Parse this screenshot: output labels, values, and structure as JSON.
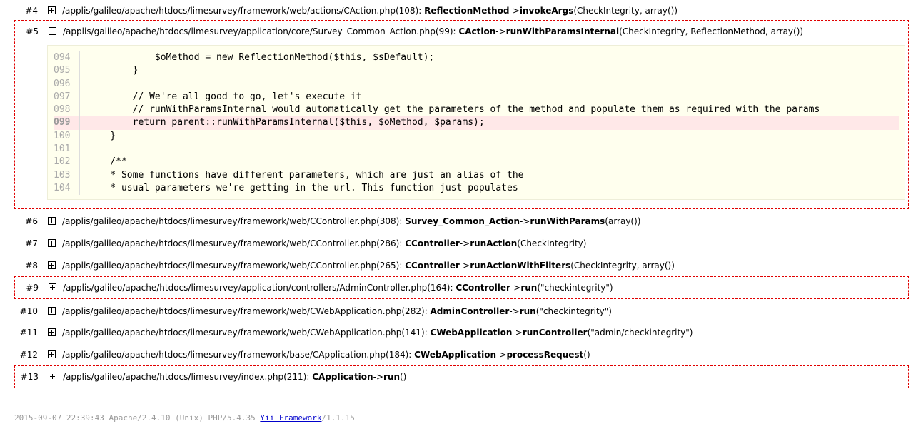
{
  "trace": [
    {
      "num": "#4",
      "path": "/applis/galileo/apache/htdocs/limesurvey/framework/web/actions/CAction.php(108):",
      "cls": "ReflectionMethod",
      "method": "invokeArgs",
      "args": "(CheckIntegrity, array())",
      "expanded": false,
      "boxed": false
    },
    {
      "num": "#5",
      "path": "/applis/galileo/apache/htdocs/limesurvey/application/core/Survey_Common_Action.php(99):",
      "cls": "CAction",
      "method": "runWithParamsInternal",
      "args": "(CheckIntegrity, ReflectionMethod, array())",
      "expanded": true,
      "boxed": true
    },
    {
      "num": "#6",
      "path": "/applis/galileo/apache/htdocs/limesurvey/framework/web/CController.php(308):",
      "cls": "Survey_Common_Action",
      "method": "runWithParams",
      "args": "(array())",
      "expanded": false,
      "boxed": false
    },
    {
      "num": "#7",
      "path": "/applis/galileo/apache/htdocs/limesurvey/framework/web/CController.php(286):",
      "cls": "CController",
      "method": "runAction",
      "args": "(CheckIntegrity)",
      "expanded": false,
      "boxed": false
    },
    {
      "num": "#8",
      "path": "/applis/galileo/apache/htdocs/limesurvey/framework/web/CController.php(265):",
      "cls": "CController",
      "method": "runActionWithFilters",
      "args": "(CheckIntegrity, array())",
      "expanded": false,
      "boxed": false
    },
    {
      "num": "#9",
      "path": "/applis/galileo/apache/htdocs/limesurvey/application/controllers/AdminController.php(164):",
      "cls": "CController",
      "method": "run",
      "args": "(\"checkintegrity\")",
      "expanded": false,
      "boxed": true
    },
    {
      "num": "#10",
      "path": "/applis/galileo/apache/htdocs/limesurvey/framework/web/CWebApplication.php(282):",
      "cls": "AdminController",
      "method": "run",
      "args": "(\"checkintegrity\")",
      "expanded": false,
      "boxed": false
    },
    {
      "num": "#11",
      "path": "/applis/galileo/apache/htdocs/limesurvey/framework/web/CWebApplication.php(141):",
      "cls": "CWebApplication",
      "method": "runController",
      "args": "(\"admin/checkintegrity\")",
      "expanded": false,
      "boxed": false
    },
    {
      "num": "#12",
      "path": "/applis/galileo/apache/htdocs/limesurvey/framework/base/CApplication.php(184):",
      "cls": "CWebApplication",
      "method": "processRequest",
      "args": "()",
      "expanded": false,
      "boxed": false
    },
    {
      "num": "#13",
      "path": "/applis/galileo/apache/htdocs/limesurvey/index.php(211):",
      "cls": "CApplication",
      "method": "run",
      "args": "()",
      "expanded": false,
      "boxed": true
    }
  ],
  "arrow": "->",
  "code": [
    {
      "ln": "094",
      "text": "            $oMethod = new ReflectionMethod($this, $sDefault);",
      "hl": false
    },
    {
      "ln": "095",
      "text": "        }",
      "hl": false
    },
    {
      "ln": "096",
      "text": "",
      "hl": false
    },
    {
      "ln": "097",
      "text": "        // We're all good to go, let's execute it",
      "hl": false
    },
    {
      "ln": "098",
      "text": "        // runWithParamsInternal would automatically get the parameters of the method and populate them as required with the params",
      "hl": false
    },
    {
      "ln": "099",
      "text": "        return parent::runWithParamsInternal($this, $oMethod, $params);",
      "hl": true
    },
    {
      "ln": "100",
      "text": "    }",
      "hl": false
    },
    {
      "ln": "101",
      "text": "",
      "hl": false
    },
    {
      "ln": "102",
      "text": "    /**",
      "hl": false
    },
    {
      "ln": "103",
      "text": "    * Some functions have different parameters, which are just an alias of the",
      "hl": false
    },
    {
      "ln": "104",
      "text": "    * usual parameters we're getting in the url. This function just populates",
      "hl": false
    }
  ],
  "footer": {
    "prefix": "2015-09-07 22:39:43 Apache/2.4.10 (Unix) PHP/5.4.35 ",
    "link": "Yii Framework",
    "suffix": "/1.1.15"
  }
}
